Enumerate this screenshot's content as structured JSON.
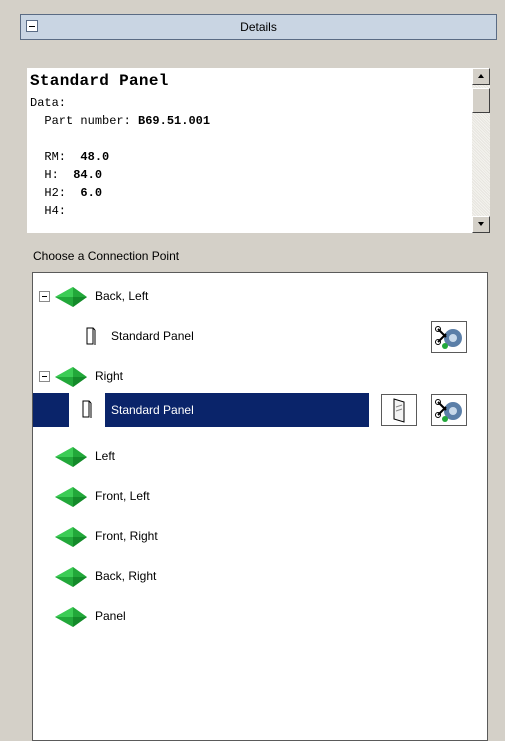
{
  "header": {
    "title": "Details"
  },
  "details": {
    "title": "Standard Panel",
    "data_label": "Data:",
    "part_number_label": "Part number:",
    "part_number": "B69.51.001",
    "rows": [
      {
        "label": "RM:",
        "value": "48.0"
      },
      {
        "label": "H:",
        "value": "84.0"
      },
      {
        "label": "H2:",
        "value": "6.0"
      },
      {
        "label": "H4:",
        "value": ""
      }
    ]
  },
  "section_label": "Choose a Connection Point",
  "tree": {
    "nodes": [
      {
        "label": "Back, Left"
      },
      {
        "label": "Standard Panel"
      },
      {
        "label": "Right"
      },
      {
        "label": "Standard Panel"
      },
      {
        "label": "Left"
      },
      {
        "label": "Front, Left"
      },
      {
        "label": "Front, Right"
      },
      {
        "label": "Back, Right"
      },
      {
        "label": "Panel"
      }
    ]
  },
  "colors": {
    "selection": "#0a246a",
    "gem": "#22a83a",
    "header_bg": "#c9d5e3"
  }
}
